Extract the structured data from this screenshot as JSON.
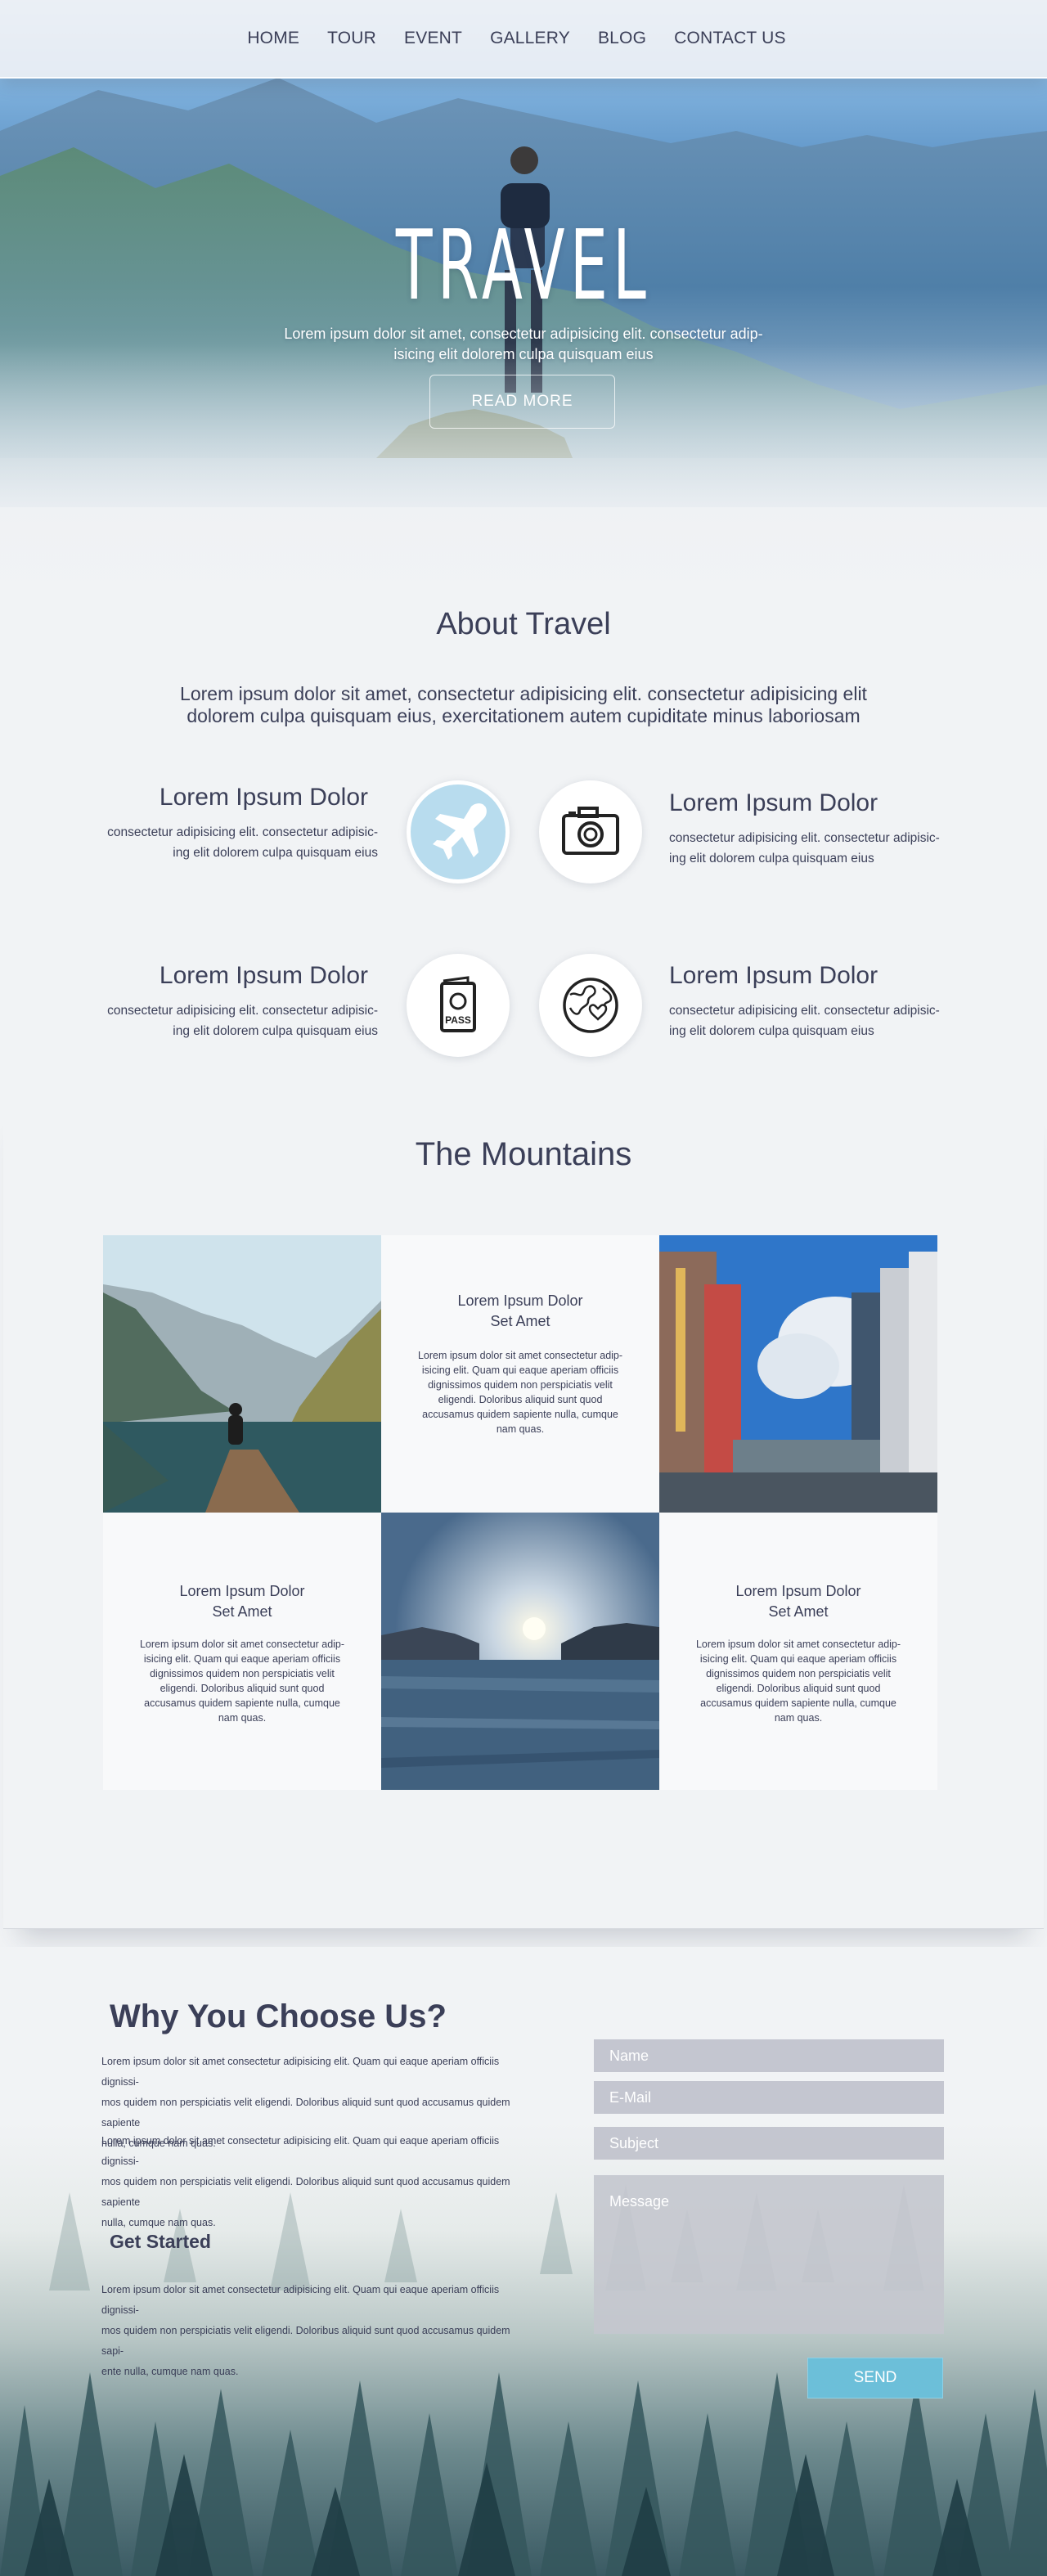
{
  "nav": {
    "items": [
      "HOME",
      "TOUR",
      "EVENT",
      "GALLERY",
      "BLOG",
      "CONTACT US"
    ]
  },
  "hero": {
    "title": "TRAVEL",
    "subtitle_line1": "Lorem ipsum dolor sit amet, consectetur adipisicing elit. consectetur adip-",
    "subtitle_line2": "isicing elit dolorem culpa quisquam eius",
    "button": "READ MORE"
  },
  "about": {
    "title": "About Travel",
    "text_line1": "Lorem ipsum dolor sit amet, consectetur adipisicing elit. consectetur adipisicing elit",
    "text_line2": "dolorem culpa quisquam eius, exercitationem autem cupiditate minus laboriosam",
    "features": [
      {
        "title": "Lorem Ipsum Dolor",
        "line1": "consectetur adipisicing elit. consectetur adipisic-",
        "line2": "ing elit dolorem culpa quisquam eius",
        "icon": "airplane-icon"
      },
      {
        "title": "Lorem Ipsum Dolor",
        "line1": "consectetur adipisicing elit. consectetur adipisic-",
        "line2": "ing elit dolorem culpa quisquam eius",
        "icon": "camera-icon"
      },
      {
        "title": "Lorem Ipsum Dolor",
        "line1": "consectetur adipisicing elit. consectetur adipisic-",
        "line2": "ing elit dolorem culpa quisquam eius",
        "icon": "passport-icon"
      },
      {
        "title": "Lorem Ipsum Dolor",
        "line1": "consectetur adipisicing elit. consectetur adipisic-",
        "line2": "ing elit dolorem culpa quisquam eius",
        "icon": "globe-heart-icon"
      }
    ],
    "passport_label": "PASS"
  },
  "mountains": {
    "title": "The Mountains",
    "cards": [
      {
        "title_line1": "Lorem Ipsum Dolor",
        "title_line2": "Set Amet",
        "body": [
          "Lorem ipsum dolor sit amet consectetur adip-",
          "isicing elit. Quam qui eaque aperiam officiis",
          "dignissimos quidem non perspiciatis velit",
          "eligendi. Doloribus aliquid sunt quod",
          "accusamus quidem sapiente nulla, cumque",
          "nam quas."
        ]
      },
      {
        "title_line1": "Lorem Ipsum Dolor",
        "title_line2": "Set Amet",
        "body": [
          "Lorem ipsum dolor sit amet consectetur adip-",
          "isicing elit. Quam qui eaque aperiam officiis",
          "dignissimos quidem non perspiciatis velit",
          "eligendi. Doloribus aliquid sunt quod",
          "accusamus quidem sapiente nulla, cumque",
          "nam quas."
        ]
      },
      {
        "title_line1": "Lorem Ipsum Dolor",
        "title_line2": "Set Amet",
        "body": [
          "Lorem ipsum dolor sit amet consectetur adip-",
          "isicing elit. Quam qui eaque aperiam officiis",
          "dignissimos quidem non perspiciatis velit",
          "eligendi. Doloribus aliquid sunt quod",
          "accusamus quidem sapiente nulla, cumque",
          "nam quas."
        ]
      }
    ]
  },
  "why": {
    "title": "Why You Choose Us?",
    "para1": [
      "Lorem ipsum dolor sit amet consectetur adipisicing elit. Quam qui eaque aperiam officiis dignissi-",
      "mos quidem non perspiciatis velit eligendi. Doloribus aliquid sunt quod accusamus quidem sapiente",
      "nulla, cumque nam quas."
    ],
    "para2": [
      "Lorem ipsum dolor sit amet consectetur adipisicing elit. Quam qui eaque aperiam officiis dignissi-",
      "mos quidem non perspiciatis velit eligendi. Doloribus aliquid sunt quod accusamus quidem sapiente",
      "nulla, cumque nam quas."
    ],
    "get_started": "Get Started",
    "para3": [
      "Lorem ipsum dolor sit amet consectetur adipisicing elit. Quam qui eaque aperiam officiis dignissi-",
      "mos quidem non perspiciatis velit eligendi. Doloribus aliquid sunt quod accusamus quidem sapi-",
      "ente nulla, cumque nam quas."
    ]
  },
  "form": {
    "name_placeholder": "Name",
    "email_placeholder": "E-Mail",
    "subject_placeholder": "Subject",
    "message_placeholder": "Message",
    "send": "SEND"
  },
  "colors": {
    "text": "#3b3f58",
    "accent": "#6cbfd9",
    "field": "#c0c2cc",
    "icon_blue": "#b8dcee"
  }
}
